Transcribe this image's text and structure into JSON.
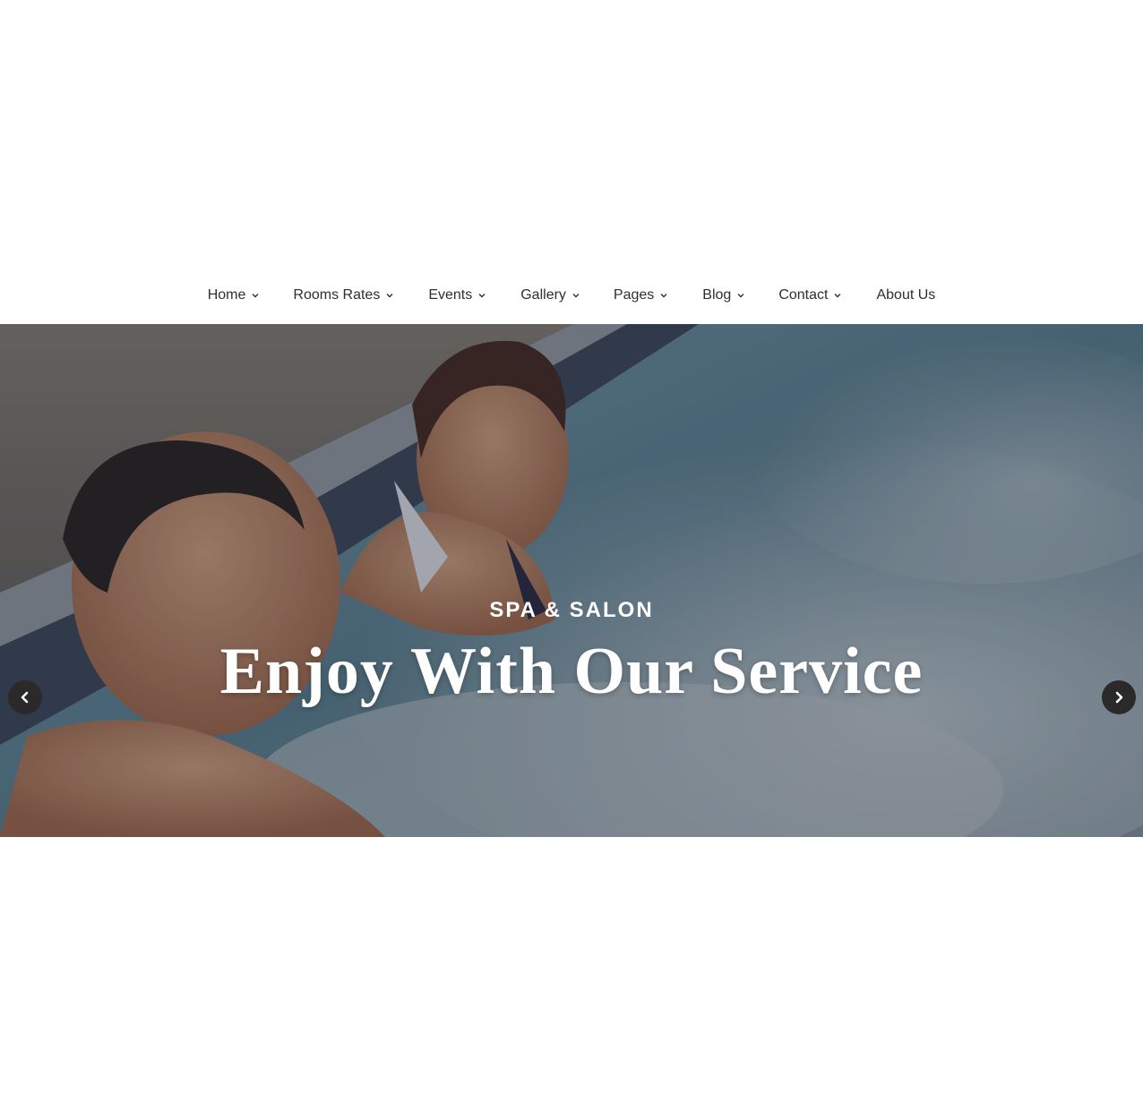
{
  "nav": {
    "items": [
      {
        "label": "Home",
        "has_dropdown": true
      },
      {
        "label": "Rooms Rates",
        "has_dropdown": true
      },
      {
        "label": "Events",
        "has_dropdown": true
      },
      {
        "label": "Gallery",
        "has_dropdown": true
      },
      {
        "label": "Pages",
        "has_dropdown": true
      },
      {
        "label": "Blog",
        "has_dropdown": true
      },
      {
        "label": "Contact",
        "has_dropdown": true
      },
      {
        "label": "About Us",
        "has_dropdown": false
      }
    ]
  },
  "hero": {
    "subtitle": "SPA & SALON",
    "title": "Enjoy With Our Service",
    "image": "couple-in-spa-jacuzzi",
    "prev_icon": "chevron-left-icon",
    "next_icon": "chevron-right-icon"
  },
  "colors": {
    "nav_text": "#2f2f2f",
    "hero_text": "#ffffff",
    "arrow_bg": "#2a2a2a",
    "water": "#6f8fa0"
  }
}
